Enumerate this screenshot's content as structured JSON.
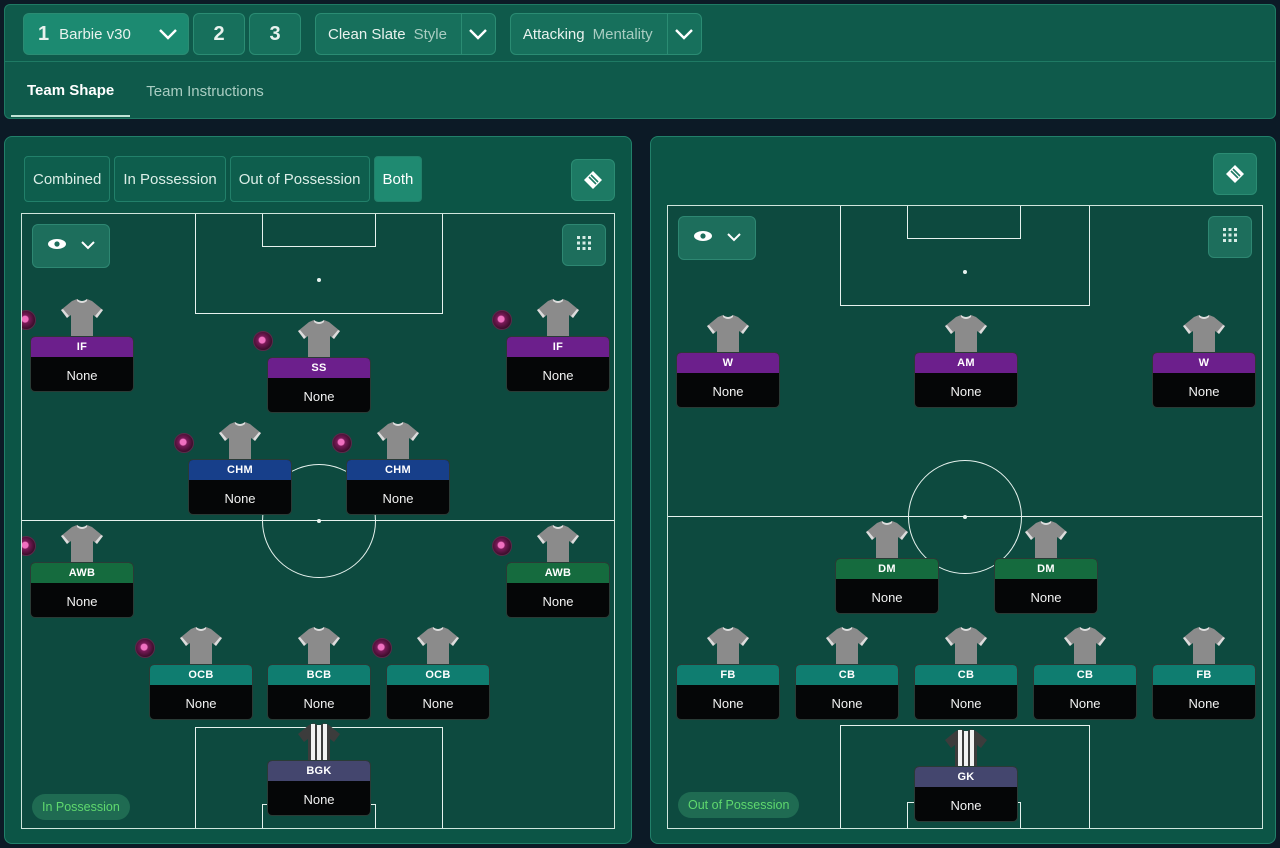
{
  "topbar": {
    "tactic_slots": [
      {
        "number": "1",
        "name": "Barbie v30"
      },
      {
        "number": "2"
      },
      {
        "number": "3"
      }
    ],
    "style": {
      "value": "Clean Slate",
      "label": "Style"
    },
    "mentality": {
      "value": "Attacking",
      "label": "Mentality"
    },
    "tabs": [
      "Team Shape",
      "Team Instructions"
    ],
    "active_tab": "Team Shape"
  },
  "left_panel": {
    "filters": [
      "Combined",
      "In Possession",
      "Out of Possession",
      "Both"
    ],
    "active_filter": "Both",
    "phase_label": "In Possession",
    "players": [
      {
        "role": "IF",
        "name": "None",
        "color": "purple"
      },
      {
        "role": "SS",
        "name": "None",
        "color": "purple"
      },
      {
        "role": "IF",
        "name": "None",
        "color": "purple"
      },
      {
        "role": "CHM",
        "name": "None",
        "color": "blue"
      },
      {
        "role": "CHM",
        "name": "None",
        "color": "blue"
      },
      {
        "role": "AWB",
        "name": "None",
        "color": "green"
      },
      {
        "role": "AWB",
        "name": "None",
        "color": "green"
      },
      {
        "role": "OCB",
        "name": "None",
        "color": "teal"
      },
      {
        "role": "BCB",
        "name": "None",
        "color": "teal"
      },
      {
        "role": "OCB",
        "name": "None",
        "color": "teal"
      },
      {
        "role": "BGK",
        "name": "None",
        "color": "slate"
      }
    ]
  },
  "right_panel": {
    "phase_label": "Out of Possession",
    "players": [
      {
        "role": "W",
        "name": "None",
        "color": "purple"
      },
      {
        "role": "AM",
        "name": "None",
        "color": "purple"
      },
      {
        "role": "W",
        "name": "None",
        "color": "purple"
      },
      {
        "role": "DM",
        "name": "None",
        "color": "green"
      },
      {
        "role": "DM",
        "name": "None",
        "color": "green"
      },
      {
        "role": "FB",
        "name": "None",
        "color": "teal"
      },
      {
        "role": "CB",
        "name": "None",
        "color": "teal"
      },
      {
        "role": "CB",
        "name": "None",
        "color": "teal"
      },
      {
        "role": "CB",
        "name": "None",
        "color": "teal"
      },
      {
        "role": "FB",
        "name": "None",
        "color": "teal"
      },
      {
        "role": "GK",
        "name": "None",
        "color": "slate"
      }
    ]
  },
  "icons": {
    "tactic_dropdown": "chevron-down-icon",
    "visibility": "eye-icon",
    "grid": "grid-icon",
    "pitch_tool": "pitch-layout-icon",
    "player_focus": "focus-dot-icon"
  },
  "colors": {
    "accent": "#1f8a71",
    "panel": "#0c5546",
    "pitch": "#0d4a3f",
    "role_purple": "#6c1f8c",
    "role_blue": "#173f8a",
    "role_green": "#156b3e",
    "role_teal": "#0f7d70",
    "role_slate": "#44466e",
    "phase_text": "#5fd86e"
  }
}
